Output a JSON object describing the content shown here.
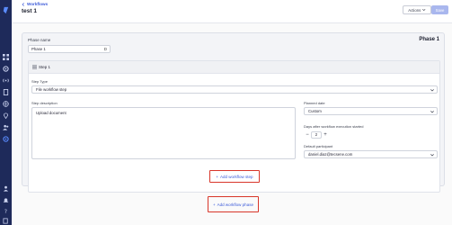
{
  "header": {
    "back_label": "Workflows",
    "title": "test 1",
    "actions_label": "Actions",
    "save_label": "Save"
  },
  "phase": {
    "name_label": "Phase name",
    "name_value": "Phase 1",
    "name_counter": "D",
    "heading": "Phase 1",
    "step": {
      "title": "Step 1",
      "type_label": "Step Type",
      "type_value": "File workflow step",
      "description_label": "Step description",
      "description_value": "Upload document",
      "planned_date_label": "Planned date",
      "planned_date_value": "Custom",
      "days_after_label": "Days after workflow execution started",
      "days_after_value": "2",
      "participant_label": "Default participant",
      "participant_value": "daniel.diaz@tecsene.com"
    },
    "add_step_label": "Add workflow step"
  },
  "add_phase_label": "Add workflow phase",
  "colors": {
    "sidebar": "#1e2a5a",
    "accent": "#3d5bd9",
    "save_disabled": "#a9b7ee",
    "highlight_border": "#d8362a"
  }
}
